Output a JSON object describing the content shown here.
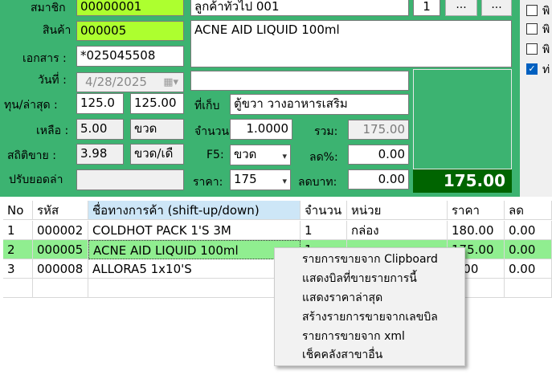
{
  "form": {
    "member_label": "สมาชิก",
    "member_code": "00000001",
    "member_name": "ลูกค้าทั่วไป 001",
    "member_qty": "1",
    "product_label": "สินค้า",
    "product_code": "000005",
    "product_desc": "ACNE AID LIQUID 100ml",
    "doc_label": "เอกสาร :",
    "doc_value": "*025045508",
    "date_label": "วันที่ :",
    "date_value": "4/28/2025",
    "cost_label": "ทุน/ล่าสุด :",
    "cost_value": "125.0",
    "cost_last": "125.00",
    "location_label": "ที่เก็บ",
    "location_value": "ตู้ขวา วางอาหารเสริม",
    "remain_label": "เหลือ :",
    "remain_value": "5.00",
    "remain_unit": "ขวด",
    "qty_label": "จำนวน",
    "qty_value": "1.0000",
    "sum_label": "รวม:",
    "sum_value": "175.00",
    "stat_label": "สถิติขาย :",
    "stat_value": "3.98",
    "stat_unit": "ขวด/เดื",
    "f5_label": "F5:",
    "f5_value": "ขวด",
    "discount_pct_label": "ลด%:",
    "discount_pct_value": "0.00",
    "adjust_label": "ปรับยอดล่า",
    "price_label": "ราคา:",
    "price_value": "175",
    "discount_baht_label": "ลดบาท:",
    "discount_baht_value": "0.00",
    "total_value": "175.00",
    "ellipsis": "..."
  },
  "options": [
    {
      "label": "พิ",
      "checked": false
    },
    {
      "label": "พิ",
      "checked": false
    },
    {
      "label": "พิ",
      "checked": false
    },
    {
      "label": "ท่",
      "checked": true
    }
  ],
  "grid": {
    "columns": [
      "No",
      "รหัส",
      "ชื่อทางการค้า (shift-up/down)",
      "จำนวน",
      "หน่วย",
      "ราคา",
      "ลด"
    ],
    "rows": [
      [
        "1",
        "000002",
        "COLDHOT PACK 1'S 3M",
        "1",
        "กล่อง",
        "180.00",
        "0.00"
      ],
      [
        "2",
        "000005",
        "ACNE AID LIQUID 100ml",
        "1",
        "",
        "175.00",
        "0.00"
      ],
      [
        "3",
        "000008",
        "ALLORA5 1x10'S",
        "",
        "",
        "0.00",
        "0.00"
      ]
    ]
  },
  "context_menu": [
    "รายการขายจาก Clipboard",
    "แสดงบิลที่ขายรายการนี้",
    "แสดงราคาล่าสุด",
    "สร้างรายการขายจากเลขบิล",
    "รายการขายจาก xml",
    "เช็คคลังสาขาอื่น"
  ]
}
